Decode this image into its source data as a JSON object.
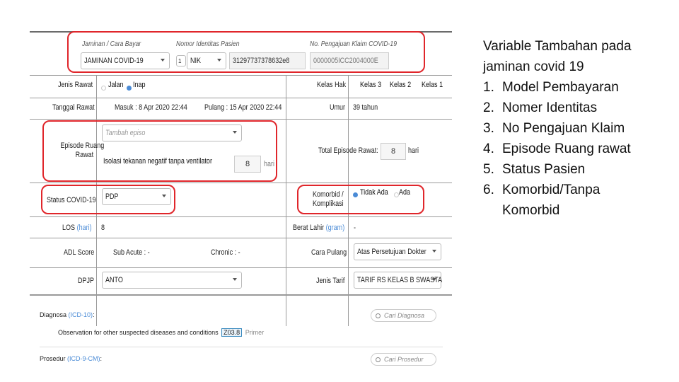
{
  "form": {
    "payment_label": "Jaminan / Cara Bayar",
    "payment_value": "JAMINAN COVID-19",
    "identity_label": "Nomor Identitas Pasien",
    "identity_step": "1",
    "identity_type": "NIK",
    "identity_number": "31297737378632e8",
    "claim_label": "No. Pengajuan Klaim COVID-19",
    "claim_number": "0000005ICC2004000E",
    "jenis_rawat_label": "Jenis Rawat",
    "jenis_rawat_options": [
      "Jalan",
      "Inap"
    ],
    "kelas_hak_label": "Kelas Hak",
    "kelas_options": [
      "Kelas 3",
      "Kelas 2",
      "Kelas 1"
    ],
    "tanggal_rawat_label": "Tanggal Rawat",
    "masuk": "Masuk : 8 Apr 2020 22:44",
    "pulang": "Pulang : 15 Apr 2020 22:44",
    "umur_label": "Umur",
    "umur_value": "39 tahun",
    "episode_label_1": "Episode Ruang",
    "episode_label_2": "Rawat",
    "episode_placeholder": "Tambah episo",
    "episode_item": "Isolasi tekanan negatif tanpa ventilator",
    "episode_days": "8",
    "hari": "hari",
    "total_episode_label": "Total Episode Rawat:",
    "total_episode_value": "8",
    "status_label": "Status COVID-19",
    "status_value": "PDP",
    "komorbid_label_1": "Komorbid /",
    "komorbid_label_2": "Komplikasi",
    "komorbid_options": [
      "Tidak Ada",
      "Ada"
    ],
    "los_label": "LOS",
    "los_unit": "(hari)",
    "los_value": "8",
    "berat_label": "Berat Lahir",
    "berat_unit": "(gram)",
    "berat_value": "-",
    "adl_label": "ADL Score",
    "sub_acute": "Sub Acute : -",
    "chronic": "Chronic : -",
    "cara_pulang_label": "Cara Pulang",
    "cara_pulang_value": "Atas Persetujuan Dokter",
    "dpjp_label": "DPJP",
    "dpjp_value": "ANTO",
    "jenis_tarif_label": "Jenis Tarif",
    "jenis_tarif_value": "TARIF RS KELAS B SWASTA",
    "diagnosa_label": "Diagnosa",
    "diagnosa_code_sys": "(ICD-10)",
    "diagnosa_search": "Cari Diagnosa",
    "diagnosa_item": "Observation for other suspected diseases and conditions",
    "diagnosa_code": "Z03.8",
    "diagnosa_type": "Primer",
    "prosedur_label": "Prosedur",
    "prosedur_code_sys": "(ICD-9-CM)",
    "prosedur_search": "Cari Prosedur"
  },
  "slide_text": {
    "title_1": "Variable Tambahan pada",
    "title_2": "jaminan covid 19",
    "items": [
      {
        "num": "1.",
        "text": "Model Pembayaran"
      },
      {
        "num": "2.",
        "text": "Nomer Identitas"
      },
      {
        "num": "3.",
        "text": "No Pengajuan Klaim"
      },
      {
        "num": "4.",
        "text": "Episode Ruang rawat"
      },
      {
        "num": "5.",
        "text": "Status Pasien"
      },
      {
        "num": "6.",
        "text": "Komorbid/Tanpa"
      }
    ],
    "item_6_cont": "Komorbid"
  },
  "colors": {
    "highlight_red": "#e0262b",
    "radio_blue": "#4a8bd6"
  }
}
